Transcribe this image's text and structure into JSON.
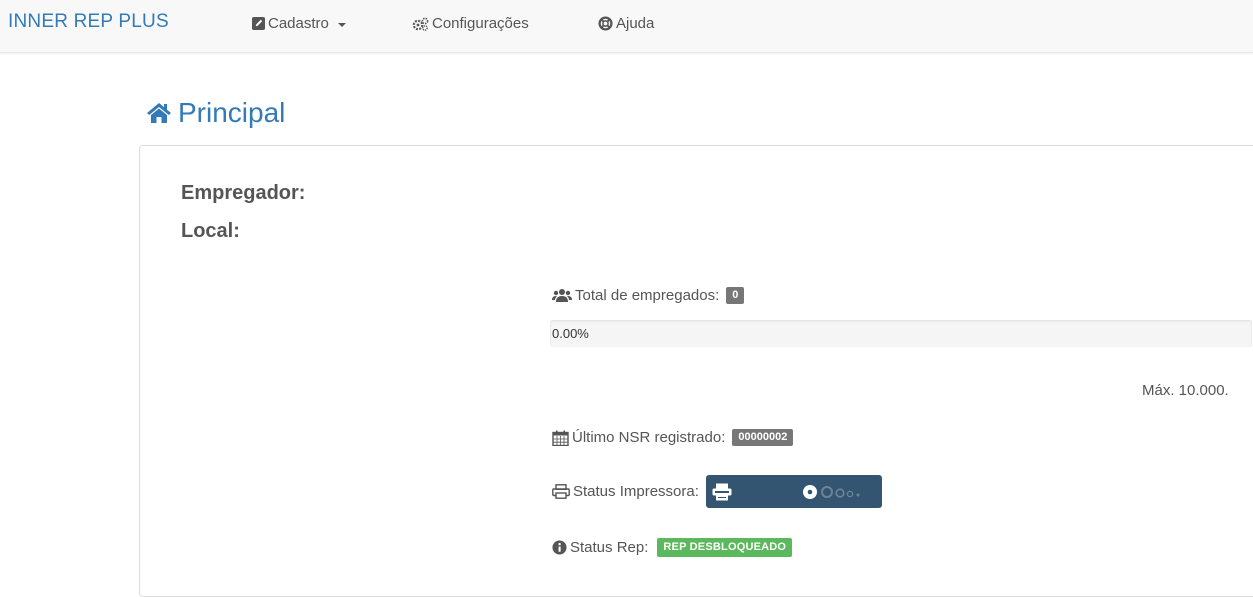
{
  "navbar": {
    "brand": "INNER REP PLUS",
    "items": [
      {
        "label": "Cadastro",
        "icon": "edit-icon"
      },
      {
        "label": "Configurações",
        "icon": "gears-icon"
      },
      {
        "label": "Ajuda",
        "icon": "lifebuoy-icon"
      }
    ]
  },
  "page": {
    "title": "Principal",
    "title_icon": "home-icon"
  },
  "panel": {
    "empregador_label": "Empregador:",
    "local_label": "Local:",
    "total_empregados_label": "Total de empregados:",
    "total_empregados_value": "0",
    "progress_text": "0.00%",
    "progress_fraction": 0.0,
    "max_text": "Máx. 10.000.",
    "ultimo_nsr_label": "Último NSR registrado:",
    "ultimo_nsr_value": "00000002",
    "status_impressora_label": "Status Impressora:",
    "status_rep_label": "Status Rep:",
    "status_rep_value": "REP DESBLOQUEADO"
  },
  "colors": {
    "accent": "#337ab7",
    "printer_box": "#335571",
    "success": "#5cb85c",
    "badge": "#777777"
  }
}
